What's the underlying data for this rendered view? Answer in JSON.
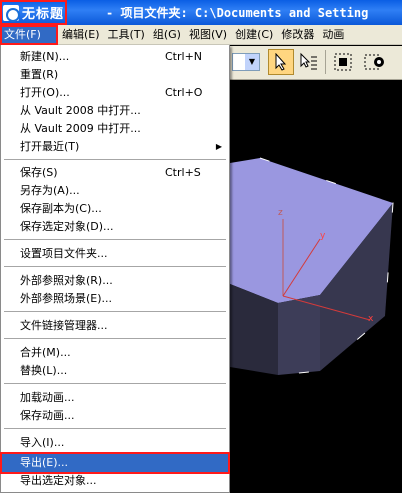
{
  "window": {
    "title": "无标题",
    "title_rest": "- 项目文件夹: C:\\Documents and Setting"
  },
  "menubar": {
    "items": [
      "文件(F)",
      "编辑(E)",
      "工具(T)",
      "组(G)",
      "视图(V)",
      "创建(C)",
      "修改器",
      "动画"
    ]
  },
  "file_menu": {
    "items": [
      {
        "label": "新建(N)...",
        "shortcut": "Ctrl+N"
      },
      {
        "label": "重置(R)",
        "shortcut": ""
      },
      {
        "label": "打开(O)...",
        "shortcut": "Ctrl+O"
      },
      {
        "label": "从 Vault 2008 中打开...",
        "shortcut": ""
      },
      {
        "label": "从 Vault 2009 中打开...",
        "shortcut": ""
      },
      {
        "label": "打开最近(T)",
        "shortcut": "",
        "submenu": true
      },
      {
        "label": "保存(S)",
        "shortcut": "Ctrl+S"
      },
      {
        "label": "另存为(A)...",
        "shortcut": ""
      },
      {
        "label": "保存副本为(C)...",
        "shortcut": ""
      },
      {
        "label": "保存选定对象(D)...",
        "shortcut": ""
      },
      {
        "label": "设置项目文件夹...",
        "shortcut": ""
      },
      {
        "label": "外部参照对象(R)...",
        "shortcut": ""
      },
      {
        "label": "外部参照场景(E)...",
        "shortcut": ""
      },
      {
        "label": "文件链接管理器...",
        "shortcut": ""
      },
      {
        "label": "合并(M)...",
        "shortcut": ""
      },
      {
        "label": "替换(L)...",
        "shortcut": ""
      },
      {
        "label": "加载动画...",
        "shortcut": ""
      },
      {
        "label": "保存动画...",
        "shortcut": ""
      },
      {
        "label": "导入(I)...",
        "shortcut": ""
      },
      {
        "label": "导出(E)...",
        "shortcut": "",
        "selected": true
      },
      {
        "label": "导出选定对象...",
        "shortcut": ""
      }
    ]
  },
  "viewport": {
    "axis_labels": [
      "z",
      "y",
      "x"
    ]
  },
  "colors": {
    "title_bar": "#0a5ee4",
    "menu_bg": "#ece9d8",
    "highlight": "#316ac5",
    "annotation": "#ff1a1a",
    "box_top": "#9a97e0",
    "box_side": "#3a3a52"
  }
}
